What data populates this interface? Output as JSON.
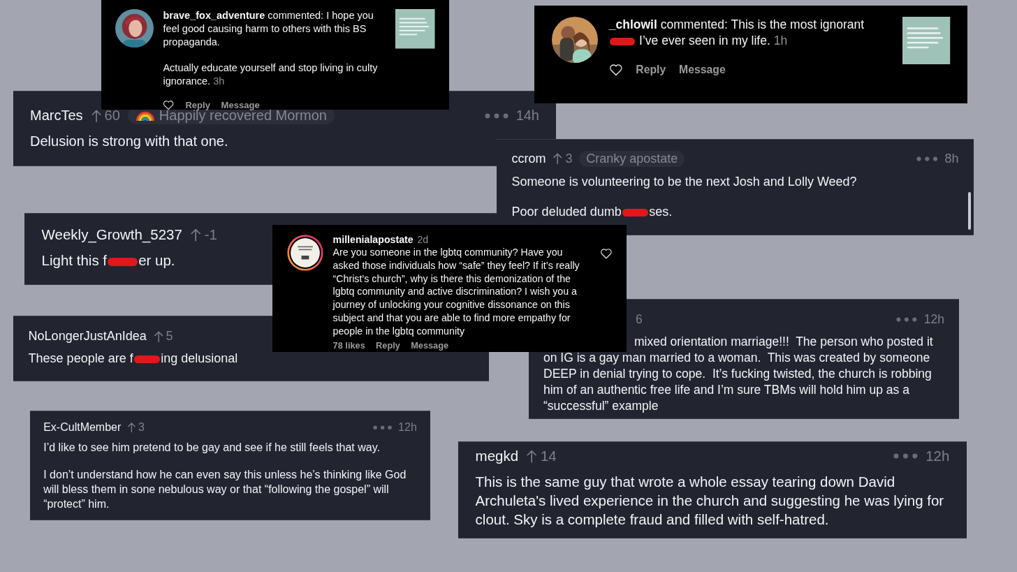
{
  "cards": [
    {
      "kind": "instagram",
      "paragraphs": [
        [
          {
            "kind": "text",
            "text": "**brave_fox_adventure** commented: I hope you feel good causing harm to others with this BS propaganda."
          }
        ],
        [
          {
            "kind": "text",
            "text": "Actually educate yourself and stop living in culty ignorance."
          }
        ]
      ],
      "time": "3h",
      "actions": [
        "Reply",
        "Message"
      ]
    },
    {
      "kind": "instagram",
      "paragraphs": [
        [
          {
            "kind": "text",
            "text": "**_chlowil** commented: This is the most ignorant "
          },
          {
            "kind": "redaction"
          },
          {
            "kind": "text",
            "text": " I’ve ever seen in my life."
          }
        ]
      ],
      "time": "1h",
      "actions": [
        "Reply",
        "Message"
      ]
    },
    {
      "kind": "reddit",
      "username": "MarcTes",
      "score": "60",
      "flair": "Happily recovered Mormon",
      "time": "14h",
      "paragraphs": [
        [
          {
            "kind": "text",
            "text": "Delusion is strong with that one."
          }
        ]
      ]
    },
    {
      "kind": "reddit",
      "username": "ccrom",
      "score": "3",
      "flair": "Cranky apostate",
      "time": "8h",
      "paragraphs": [
        [
          {
            "kind": "text",
            "text": "Someone is volunteering to be the next Josh and Lolly Weed?"
          }
        ],
        [
          {
            "kind": "text",
            "text": "Poor deluded dumb"
          },
          {
            "kind": "redaction"
          },
          {
            "kind": "text",
            "text": "ses."
          }
        ]
      ]
    },
    {
      "kind": "reddit",
      "username": "Weekly_Growth_5237",
      "score": "-1",
      "paragraphs": [
        [
          {
            "kind": "text",
            "text": "Light this f"
          },
          {
            "kind": "redaction"
          },
          {
            "kind": "text",
            "text": "er up."
          }
        ]
      ]
    },
    {
      "kind": "instagram",
      "username": "millenialapostate",
      "time": "2d",
      "paragraphs": [
        [
          {
            "kind": "text",
            "text": "Are you someone in the lgbtq community? Have you asked those individuals how “safe” they feel? If it’s really “Christ’s church”, why is there this demonization of the lgbtq community and active discrimination? I wish you a journey of unlocking your cognitive dissonance on this subject and that you are able to find more empathy for people in the lgbtq community"
          }
        ]
      ],
      "likes": "78 likes",
      "actions": [
        "Reply",
        "Message"
      ]
    },
    {
      "kind": "reddit",
      "username": "NoLongerJustAnIdea",
      "score": "5",
      "paragraphs": [
        [
          {
            "kind": "text",
            "text": "These people are f"
          },
          {
            "kind": "redaction"
          },
          {
            "kind": "text",
            "text": "ing delusional"
          }
        ]
      ]
    },
    {
      "kind": "reddit",
      "score": "6",
      "time": "12h",
      "paragraphs": [
        [
          {
            "kind": "text",
            "text": "mixed orientation marriage!!!  The person who posted it on IG is a gay man married to a woman.  This was created by someone DEEP in denial trying to cope.  It’s fucking twisted, the church is robbing him of an authentic free life and I’m sure TBMs will hold him up as a “successful” example"
          }
        ]
      ]
    },
    {
      "kind": "reddit",
      "username": "Ex-CultMember",
      "score": "3",
      "time": "12h",
      "paragraphs": [
        [
          {
            "kind": "text",
            "text": "I’d like to see him pretend to be gay and see if he still feels that way."
          }
        ],
        [
          {
            "kind": "text",
            "text": "I don’t understand how he can even say this unless he’s thinking like God will bless them in sone nebulous way or that “following the gospel” will “protect” him."
          }
        ]
      ]
    },
    {
      "kind": "reddit",
      "username": "megkd",
      "score": "14",
      "time": "12h",
      "paragraphs": [
        [
          {
            "kind": "text",
            "text": "This is the same guy that wrote a whole essay tearing down David Archuleta's lived experience in the church and suggesting he was lying for clout. Sky is a complete fraud and filled with self-hatred."
          }
        ]
      ]
    }
  ]
}
